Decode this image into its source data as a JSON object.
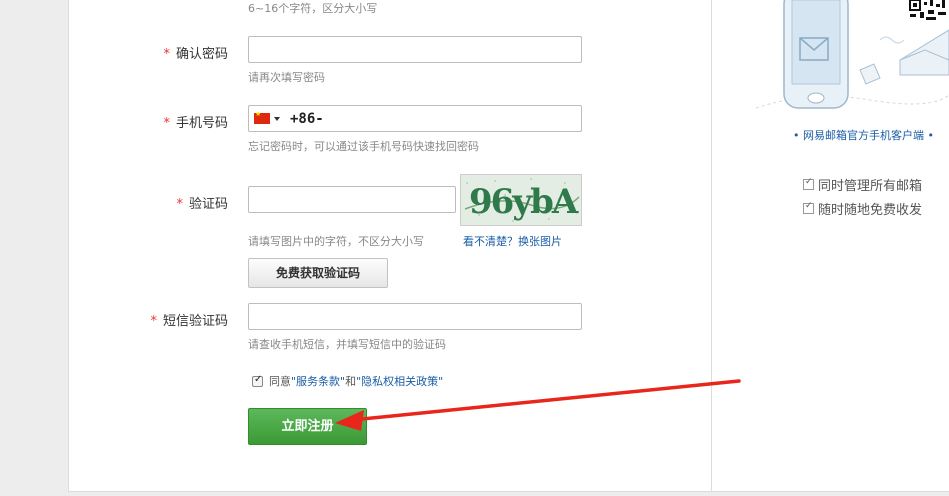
{
  "password_hint": "6~16个字符，区分大小写",
  "confirm_password": {
    "required_mark": "*",
    "label": "确认密码",
    "value": "",
    "hint": "请再次填写密码"
  },
  "phone": {
    "required_mark": "*",
    "label": "手机号码",
    "country_flag": "china-flag-icon",
    "prefix": "+86-",
    "value": "",
    "hint": "忘记密码时，可以通过该手机号码快速找回密码"
  },
  "captcha": {
    "required_mark": "*",
    "label": "验证码",
    "value": "",
    "image_text": "96ybA",
    "refresh_link": "看不清楚？换张图片",
    "hint": "请填写图片中的字符，不区分大小写",
    "get_code_button": "免费获取验证码"
  },
  "sms_code": {
    "required_mark": "*",
    "label": "短信验证码",
    "value": "",
    "hint": "请查收手机短信，并填写短信中的验证码"
  },
  "agreement": {
    "checked": true,
    "prefix": "同意",
    "terms_link": "\"服务条款\"",
    "and": "和",
    "privacy_link": "\"隐私权相关政策\""
  },
  "register_button": "立即注册",
  "sidebar": {
    "mobile_caption": "• 网易邮箱官方手机客户端 •",
    "features": [
      "同时管理所有邮箱",
      "随时随地免费收发"
    ]
  },
  "colors": {
    "accent_green": "#43a33c",
    "link_blue": "#1a5ca6",
    "required_red": "#e33",
    "annotation_arrow": "#e8261b"
  }
}
